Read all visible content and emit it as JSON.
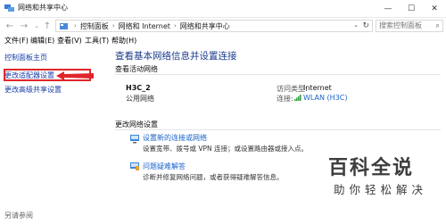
{
  "window": {
    "title": "网络和共享中心"
  },
  "address": {
    "crumbs": [
      "控制面板",
      "网络和 Internet",
      "网络和共享中心"
    ],
    "search_placeholder": "搜索控制面板"
  },
  "menu": [
    "文件(F)",
    "编辑(E)",
    "查看(V)",
    "工具(T)",
    "帮助(H)"
  ],
  "sidebar": {
    "links": [
      "控制面板主页",
      "更改适配器设置",
      "更改高级共享设置"
    ],
    "see_also": "另请参阅"
  },
  "main": {
    "title": "查看基本网络信息并设置连接",
    "active_header": "查看活动网络",
    "network": {
      "name": "H3C_2",
      "type": "公用网络",
      "access_label": "访问类型:",
      "access_value": "Internet",
      "conn_label": "连接:",
      "conn_value": "WLAN (H3C)"
    },
    "change_header": "更改网络设置",
    "tasks": [
      {
        "title": "设置新的连接或网络",
        "desc": "设置宽带、拨号或 VPN 连接；或设置路由器或接入点。"
      },
      {
        "title": "问题疑难解答",
        "desc": "诊断并修复网络问题，或者获得疑难解答信息。"
      }
    ]
  },
  "watermark": {
    "main": "百科全说",
    "sub": "助你轻松解决"
  },
  "colors": {
    "link": "#1a62c8",
    "title": "#1a3a8a",
    "highlight": "#e0262b"
  }
}
